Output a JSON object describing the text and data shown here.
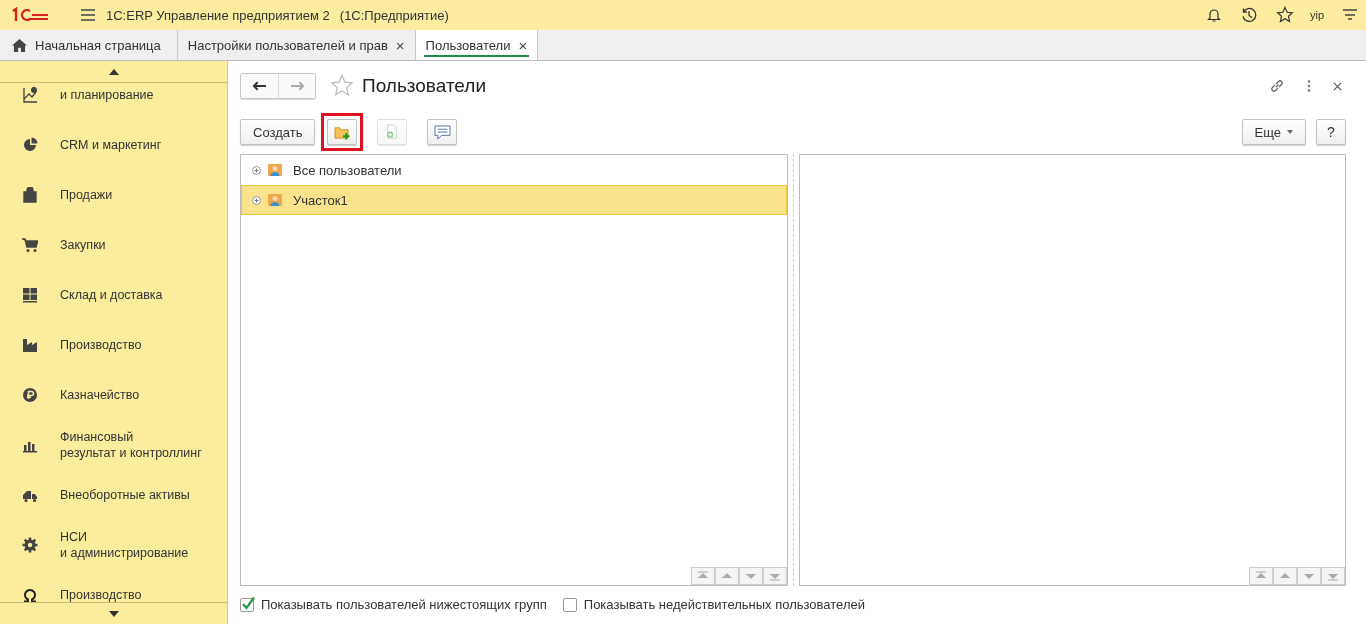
{
  "app": {
    "title": "1С:ERP Управление предприятием 2",
    "subtitle": "(1С:Предприятие)",
    "user": "yip"
  },
  "tabs": [
    {
      "label": "Начальная страница",
      "kind": "home",
      "selected": false
    },
    {
      "label": "Настройки пользователей и прав",
      "kind": "closable",
      "close": "×",
      "selected": false
    },
    {
      "label": "Пользователи",
      "kind": "closable",
      "close": "×",
      "selected": true
    }
  ],
  "sidebar": {
    "items": [
      {
        "label": "и планирование"
      },
      {
        "label": "CRM и маркетинг"
      },
      {
        "label": "Продажи"
      },
      {
        "label": "Закупки"
      },
      {
        "label": "Склад и доставка"
      },
      {
        "label": "Производство"
      },
      {
        "label": "Казначейство"
      },
      {
        "label": "Финансовый\nрезультат и контроллинг"
      },
      {
        "label": "Внеоборотные активы"
      },
      {
        "label": "НСИ\nи администрирование"
      },
      {
        "label": "Производство"
      }
    ]
  },
  "page": {
    "title": "Пользователи",
    "create_button": "Создать",
    "add_group_highlighted": true,
    "add_item_disabled": true,
    "more_button": "Еще",
    "help_button": "?"
  },
  "tree": {
    "rows": [
      {
        "label": "Все пользователи",
        "selected": false
      },
      {
        "label": "Участок1",
        "selected": true
      }
    ]
  },
  "options": [
    {
      "label": "Показывать пользователей нижестоящих групп",
      "checked": true
    },
    {
      "label": "Показывать недействительных пользователей",
      "checked": false
    }
  ]
}
